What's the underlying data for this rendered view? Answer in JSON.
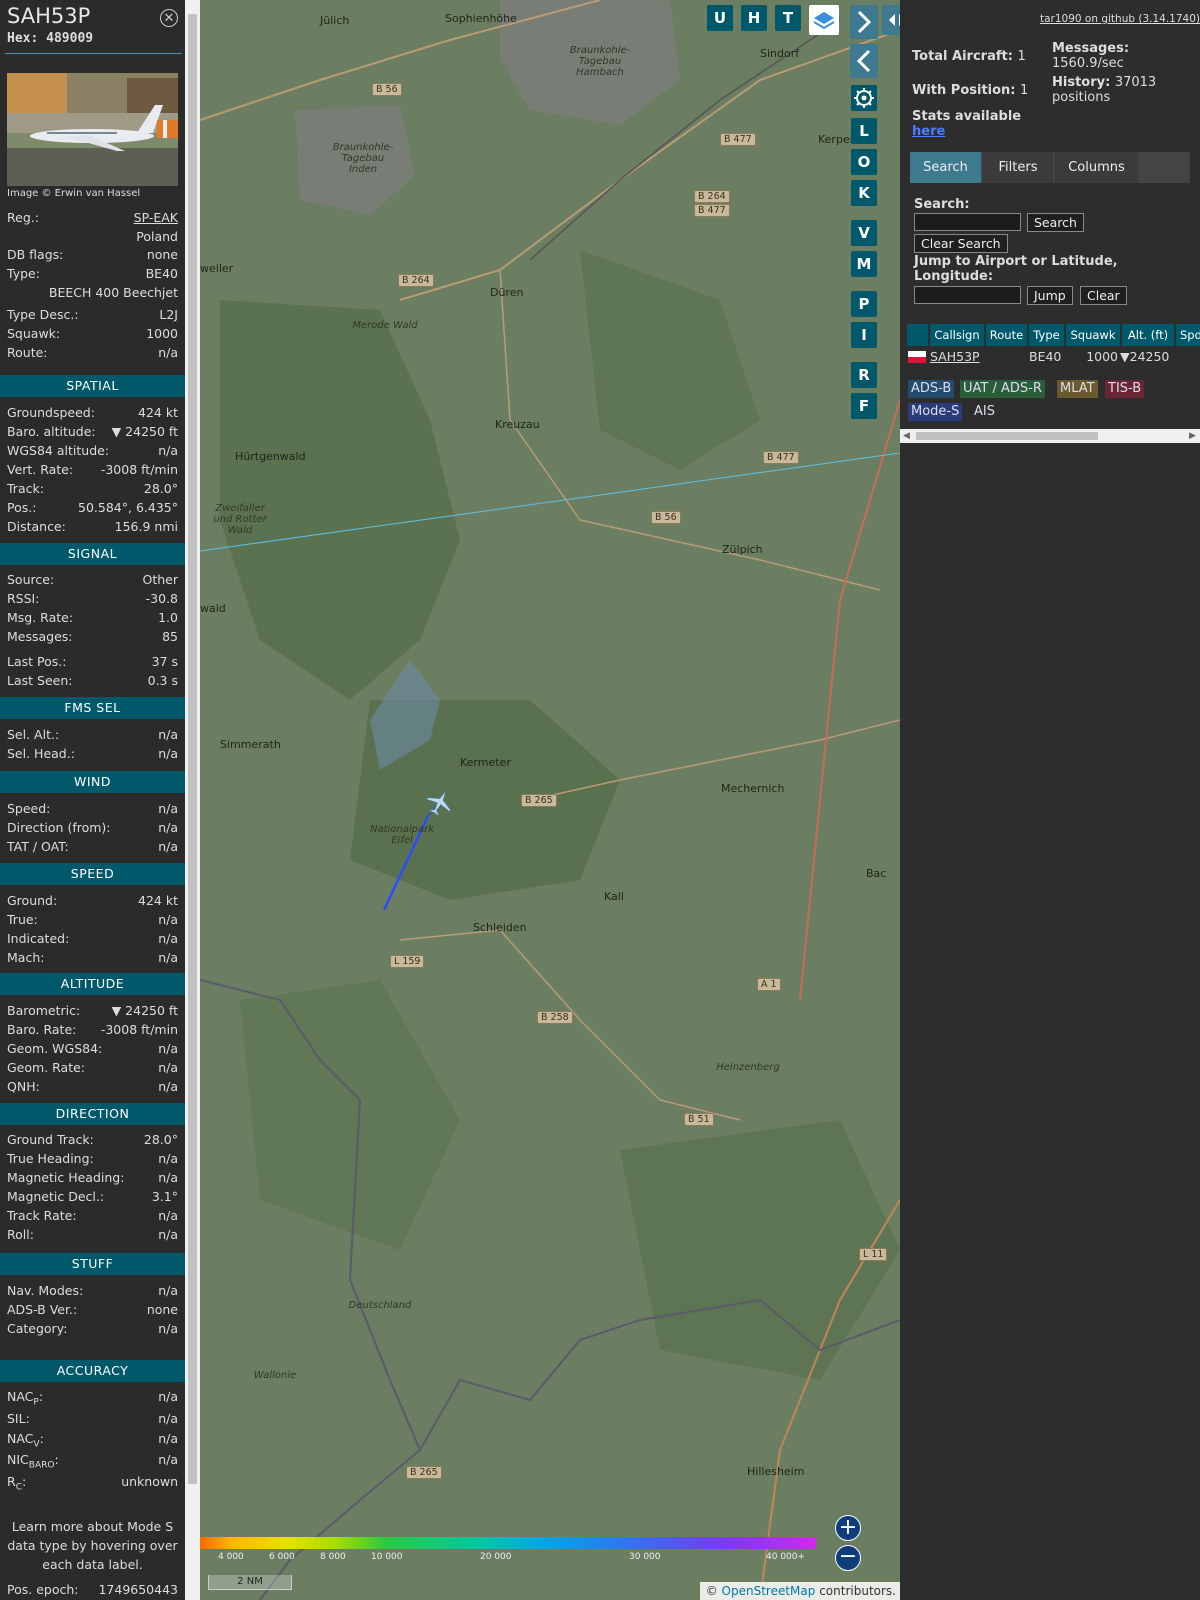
{
  "aircraft": {
    "callsign": "SAH53P",
    "hex_label": "Hex:",
    "hex": "489009",
    "image_caption": "Image © Erwin van Hassel",
    "reg_label": "Reg.:",
    "reg": "SP-EAK",
    "country": "Poland",
    "dbflags_label": "DB flags:",
    "dbflags": "none",
    "type_label": "Type:",
    "type": "BE40",
    "type_full": "BEECH 400 Beechjet",
    "typedesc_label": "Type Desc.:",
    "typedesc": "L2J",
    "squawk_label": "Squawk:",
    "squawk": "1000",
    "route_label": "Route:",
    "route": "n/a"
  },
  "sections": {
    "spatial": "SPATIAL",
    "signal": "SIGNAL",
    "fms": "FMS SEL",
    "wind": "WIND",
    "speed": "SPEED",
    "altitude": "ALTITUDE",
    "direction": "DIRECTION",
    "stuff": "STUFF",
    "accuracy": "ACCURACY"
  },
  "spatial": [
    {
      "k": "Groundspeed:",
      "v": "424 kt"
    },
    {
      "k": "Baro. altitude:",
      "v": "▼ 24250 ft"
    },
    {
      "k": "WGS84 altitude:",
      "v": "n/a"
    },
    {
      "k": "Vert. Rate:",
      "v": "-3008 ft/min"
    },
    {
      "k": "Track:",
      "v": "28.0°"
    },
    {
      "k": "Pos.:",
      "v": "50.584°, 6.435°"
    },
    {
      "k": "Distance:",
      "v": "156.9 nmi"
    }
  ],
  "signal": [
    {
      "k": "Source:",
      "v": "Other"
    },
    {
      "k": "RSSI:",
      "v": "-30.8"
    },
    {
      "k": "Msg. Rate:",
      "v": "1.0"
    },
    {
      "k": "Messages:",
      "v": "85"
    },
    {
      "k": "Last Pos.:",
      "v": "37 s"
    },
    {
      "k": "Last Seen:",
      "v": "0.3 s"
    }
  ],
  "fms": [
    {
      "k": "Sel. Alt.:",
      "v": "n/a"
    },
    {
      "k": "Sel. Head.:",
      "v": "n/a"
    }
  ],
  "wind": [
    {
      "k": "Speed:",
      "v": "n/a"
    },
    {
      "k": "Direction (from):",
      "v": "n/a"
    },
    {
      "k": "TAT / OAT:",
      "v": "n/a"
    }
  ],
  "speed": [
    {
      "k": "Ground:",
      "v": "424 kt"
    },
    {
      "k": "True:",
      "v": "n/a"
    },
    {
      "k": "Indicated:",
      "v": "n/a"
    },
    {
      "k": "Mach:",
      "v": "n/a"
    }
  ],
  "altitude": [
    {
      "k": "Barometric:",
      "v": "▼ 24250 ft"
    },
    {
      "k": "Baro. Rate:",
      "v": "-3008 ft/min"
    },
    {
      "k": "Geom. WGS84:",
      "v": "n/a"
    },
    {
      "k": "Geom. Rate:",
      "v": "n/a"
    },
    {
      "k": "QNH:",
      "v": "n/a"
    }
  ],
  "direction": [
    {
      "k": "Ground Track:",
      "v": "28.0°"
    },
    {
      "k": "True Heading:",
      "v": "n/a"
    },
    {
      "k": "Magnetic Heading:",
      "v": "n/a"
    },
    {
      "k": "Magnetic Decl.:",
      "v": "3.1°"
    },
    {
      "k": "Track Rate:",
      "v": "n/a"
    },
    {
      "k": "Roll:",
      "v": "n/a"
    }
  ],
  "stuff": [
    {
      "k": "Nav. Modes:",
      "v": "n/a"
    },
    {
      "k": "ADS-B Ver.:",
      "v": "none"
    },
    {
      "k": "Category:",
      "v": "n/a"
    }
  ],
  "accuracy": [
    {
      "k": "NAC",
      "sub": "P",
      "v": "n/a"
    },
    {
      "k": "SIL:",
      "sub": "",
      "v": "n/a"
    },
    {
      "k": "NAC",
      "sub": "V",
      "v": "n/a"
    },
    {
      "k": "NIC",
      "sub": "BARO",
      "v": "n/a"
    },
    {
      "k": "R",
      "sub": "C",
      "v": "unknown"
    }
  ],
  "footer_note": "Learn more about Mode S data type by hovering over each data label.",
  "pos_epoch_label": "Pos. epoch:",
  "pos_epoch": "1749650443",
  "map_buttons": {
    "top": [
      "U",
      "H",
      "T"
    ],
    "side": [
      "L",
      "O",
      "K",
      "V",
      "M",
      "P",
      "I",
      "R",
      "F"
    ]
  },
  "map_labels": [
    "Jülich",
    "Sophienhöhe",
    "Braunkohle-Tagebau Hambach",
    "Sindorf",
    "Kerpen",
    "B 56",
    "B 477",
    "B 264",
    "B 477",
    "Braunkohle-Tagebau Inden",
    "B 264",
    "Düren",
    "Merode Wald",
    "Kreuzau",
    "Hürtgenwald",
    "Zweifaller und Rotter Wald",
    "B 56",
    "Zülpich",
    "B 477",
    "Simmerath",
    "Kermeter",
    "B 265",
    "Mechernich",
    "Nationalpark Eifel",
    "Kall",
    "Schleiden",
    "L 159",
    "B 258",
    "A 1",
    "Heinzenberg",
    "B 51",
    "Deutschland",
    "Wallonie",
    "B 265",
    "Hillesheim",
    "L 11",
    "weiler",
    "wald",
    "Bac"
  ],
  "altitude_scale": [
    "4 000",
    "6 000",
    "8 000",
    "10 000",
    "20 000",
    "30 000",
    "40 000+"
  ],
  "scale_bar": "2 NM",
  "attribution_prefix": "© ",
  "attribution_link": "OpenStreetMap",
  "attribution_suffix": " contributors.",
  "right": {
    "github": "tar1090 on github (3.14.1740)",
    "total_aircraft_label": "Total Aircraft:",
    "total_aircraft": "1",
    "messages_label": "Messages:",
    "messages": "1560.9/sec",
    "with_position_label": "With Position:",
    "with_position": "1",
    "history_label": "History:",
    "history": "37013 positions",
    "stats_label": "Stats available",
    "stats_link": "here",
    "tabs": [
      "Search",
      "Filters",
      "Columns"
    ],
    "search_label": "Search:",
    "search_button": "Search",
    "clear_search_button": "Clear Search",
    "jump_label": "Jump to Airport or Latitude, Longitude:",
    "jump_button": "Jump",
    "clear_button": "Clear",
    "table_headers": [
      "",
      "Callsign",
      "Route",
      "Type",
      "Squawk",
      "Alt. (ft)",
      "Spd"
    ],
    "table_row": {
      "callsign": "SAH53P",
      "route": "",
      "type": "BE40",
      "squawk": "1000",
      "alt": "▼24250"
    },
    "badges": [
      "ADS-B",
      "UAT / ADS-R",
      "MLAT",
      "TIS-B",
      "Mode-S",
      "AIS"
    ]
  },
  "colors": {
    "accent": "#00596b",
    "link": "#3366ff",
    "map": "#6c7e62"
  }
}
